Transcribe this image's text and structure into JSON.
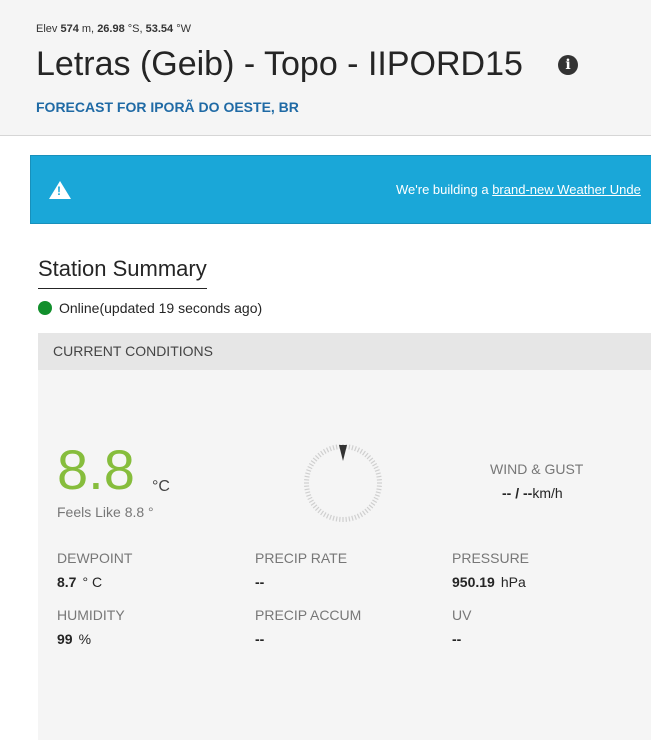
{
  "header": {
    "elev_prefix": "Elev",
    "elev_value": "574",
    "elev_unit": "m,",
    "lat_value": "26.98",
    "lat_unit": "°S,",
    "lon_value": "53.54",
    "lon_unit": "°W",
    "title": "Letras (Geib) - Topo - IIPORD15",
    "forecast_link": "FORECAST FOR IPORÃ DO OESTE, BR"
  },
  "banner": {
    "text_prefix": "We're building a",
    "link_text": "brand-new Weather Unde"
  },
  "summary": {
    "heading": "Station Summary",
    "status": "Online(updated 19 seconds ago)",
    "status_color": "#128f2c"
  },
  "current": {
    "section_title": "CURRENT CONDITIONS",
    "temperature": "8.8",
    "temperature_unit": "°C",
    "feels_like": "Feels Like 8.8 °",
    "wind_label": "WIND & GUST",
    "wind_value": "-- / --",
    "wind_unit": "km/h",
    "stats": {
      "dewpoint": {
        "label": "DEWPOINT",
        "value": "8.7",
        "unit": "° C"
      },
      "precip_rate": {
        "label": "PRECIP RATE",
        "value": "--"
      },
      "pressure": {
        "label": "PRESSURE",
        "value": "950.19",
        "unit": "hPa"
      },
      "humidity": {
        "label": "HUMIDITY",
        "value": "99",
        "unit": "%"
      },
      "precip_accum": {
        "label": "PRECIP ACCUM",
        "value": "--"
      },
      "uv": {
        "label": "UV",
        "value": "--"
      }
    }
  },
  "colors": {
    "temperature": "#86bd3c",
    "banner": "#1aa7d8",
    "link": "#1f6aa5"
  }
}
